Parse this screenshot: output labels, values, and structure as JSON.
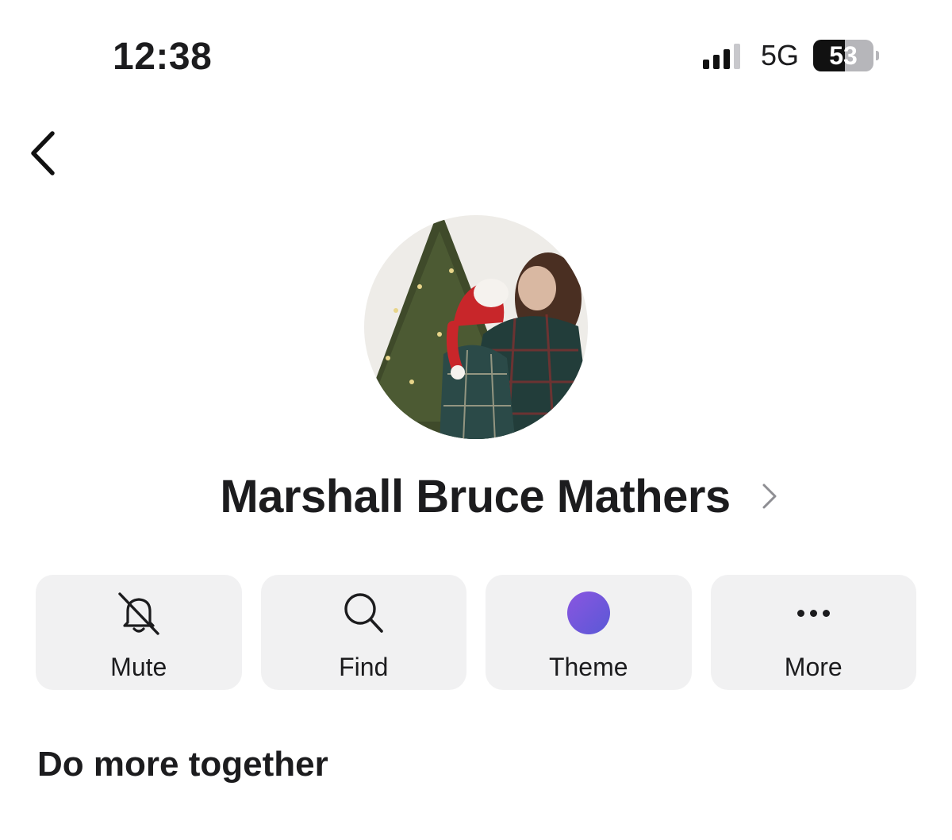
{
  "status_bar": {
    "time": "12:38",
    "network": "5G",
    "battery_percent": "53",
    "battery_level": 0.53,
    "signal_bars_filled": 3
  },
  "navigation": {
    "back_icon": "chevron-left-icon"
  },
  "profile": {
    "name": "Marshall Bruce Mathers",
    "name_chevron_icon": "chevron-right-icon",
    "avatar": "profile-photo"
  },
  "actions": [
    {
      "label": "Mute",
      "icon": "bell-slash-icon"
    },
    {
      "label": "Find",
      "icon": "search-icon"
    },
    {
      "label": "Theme",
      "icon": "theme-color-dot",
      "color": "#7257DC"
    },
    {
      "label": "More",
      "icon": "ellipsis-icon"
    }
  ],
  "section": {
    "title": "Do more together"
  }
}
